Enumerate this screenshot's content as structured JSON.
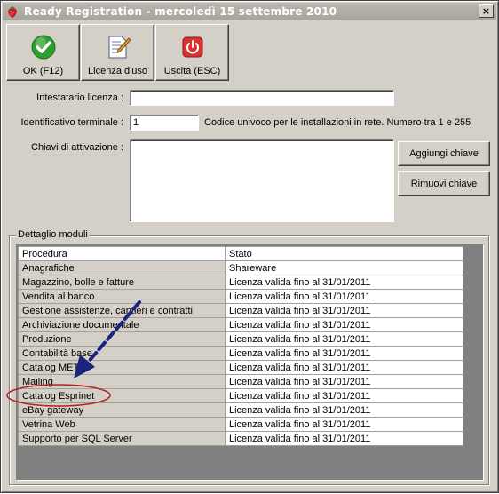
{
  "window": {
    "title": "Ready Registration - mercoledì 15 settembre 2010",
    "close_label": "×"
  },
  "toolbar": {
    "ok_label": "OK (F12)",
    "license_label": "Licenza d'uso",
    "exit_label": "Uscita (ESC)"
  },
  "form": {
    "holder_label": "Intestatario licenza :",
    "holder_value": "",
    "terminal_label": "Identificativo terminale :",
    "terminal_value": "1",
    "terminal_hint": "Codice univoco per le installazioni in rete. Numero tra 1 e 255",
    "keys_label": "Chiavi di attivazione :",
    "keys_value": "",
    "add_key_label": "Aggiungi chiave",
    "remove_key_label": "Rimuovi chiave"
  },
  "modules": {
    "group_title": "Dettaglio moduli",
    "columns": [
      "Procedura",
      "Stato"
    ],
    "rows": [
      [
        "Anagrafiche",
        "Shareware"
      ],
      [
        "Magazzino, bolle e fatture",
        "Licenza valida fino al 31/01/2011"
      ],
      [
        "Vendita al banco",
        "Licenza valida fino al 31/01/2011"
      ],
      [
        "Gestione assistenze, cantieri e contratti",
        "Licenza valida fino al 31/01/2011"
      ],
      [
        "Archiviazione documentale",
        "Licenza valida fino al 31/01/2011"
      ],
      [
        "Produzione",
        "Licenza valida fino al 31/01/2011"
      ],
      [
        "Contabilità base",
        "Licenza valida fino al 31/01/2011"
      ],
      [
        "Catalog MET",
        "Licenza valida fino al 31/01/2011"
      ],
      [
        "Mailing",
        "Licenza valida fino al 31/01/2011"
      ],
      [
        "Catalog Esprinet",
        "Licenza valida fino al 31/01/2011"
      ],
      [
        "eBay gateway",
        "Licenza valida fino al 31/01/2011"
      ],
      [
        "Vetrina Web",
        "Licenza valida fino al 31/01/2011"
      ],
      [
        "Supporto per SQL Server",
        "Licenza valida fino al 31/01/2011"
      ]
    ]
  },
  "colors": {
    "annotation_arrow": "#1a237e",
    "annotation_ellipse": "#b22222",
    "ok_icon": "#2e9e2e",
    "exit_icon": "#d93030"
  },
  "icons": {
    "app": "strawberry-icon",
    "ok": "check-icon",
    "license": "document-pencil-icon",
    "exit": "power-icon"
  }
}
